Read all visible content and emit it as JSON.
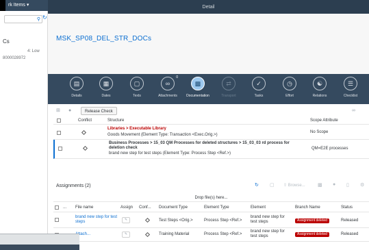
{
  "left_pane": {
    "header_label": "rk Items ▾",
    "item_title": "Cs",
    "item_priority": "4: Low",
    "item_id": "8000028972",
    "search_icon": "search-icon",
    "refresh_icon": "refresh-icon"
  },
  "header": {
    "title": "Detail",
    "page_title": "MSK_SP08_DEL_STR_DOCs"
  },
  "nav_tabs": [
    {
      "label": "Details",
      "icon": "details-icon"
    },
    {
      "label": "Dates",
      "icon": "calendar-icon"
    },
    {
      "label": "Texts",
      "icon": "chat-icon"
    },
    {
      "label": "Attachments",
      "icon": "paperclip-icon",
      "badge": "0"
    },
    {
      "label": "Documentation",
      "icon": "documentation-icon",
      "active": true
    },
    {
      "label": "Transport",
      "icon": "transport-icon",
      "disabled": true
    },
    {
      "label": "Tasks",
      "icon": "tasks-icon"
    },
    {
      "label": "Effort",
      "icon": "effort-icon"
    },
    {
      "label": "Relations",
      "icon": "relations-icon"
    },
    {
      "label": "Checklist",
      "icon": "checklist-icon"
    }
  ],
  "structure": {
    "release_check_label": "Release Check",
    "columns": [
      "Conflict",
      "Structure",
      "Scope Attribute"
    ],
    "rows": [
      {
        "path": "Libraries > Executable Library",
        "detail": "Goods Movement  (Element Type: Transaction <Exec.Orig.>)",
        "scope": "No Scope"
      },
      {
        "path": "Business Processes > 15_03 QM Processes for deleted structures > 15_03_03 rd process for deletion check",
        "detail": "brand new step for test steps  (Element Type: Process Step <Ref.>)",
        "scope": "QM=E2E processes"
      }
    ]
  },
  "assignments": {
    "title": "Assignments (2)",
    "browse_label": "Browse...",
    "drop_label": "Drop file(s) here...",
    "columns": [
      "...",
      "File name",
      "Assign",
      "Conf...",
      "Document Type",
      "Element Type",
      "Element",
      "Branch Name",
      "Status"
    ],
    "rows": [
      {
        "file_name": "brand new step for test steps",
        "doc_type": "Test Steps <Orig.>",
        "element_type": "Process Step <Ref.>",
        "element": "brand new step for test steps",
        "branch": "Assignment deleted",
        "status": "Released"
      },
      {
        "file_name": "Attach...",
        "doc_type": "Training Material",
        "element_type": "Process Step <Ref.>",
        "element": "brand new step for test steps",
        "branch": "Assignment deleted",
        "status": "Released"
      }
    ]
  },
  "colors": {
    "shell": "#354a5f",
    "accent": "#0a6ed1",
    "error": "#bb0000",
    "library_path": "#bb0000"
  }
}
